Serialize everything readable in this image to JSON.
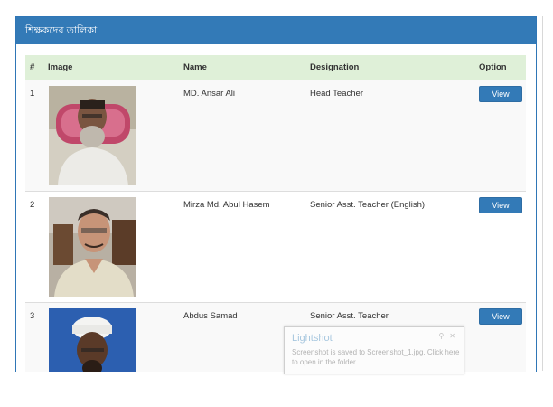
{
  "panel": {
    "title": "শিক্ষকদের তালিকা"
  },
  "table": {
    "headers": {
      "num": "#",
      "image": "Image",
      "name": "Name",
      "designation": "Designation",
      "option": "Option"
    },
    "rows": [
      {
        "num": "1",
        "name": "MD. Ansar Ali",
        "designation": "Head Teacher",
        "button": "View",
        "photo_alt": "teacher-photo"
      },
      {
        "num": "2",
        "name": "Mirza Md. Abul Hasem",
        "designation": "Senior Asst. Teacher (English)",
        "button": "View",
        "photo_alt": "teacher-photo"
      },
      {
        "num": "3",
        "name": "Abdus Samad",
        "designation": "Senior Asst. Teacher",
        "button": "View",
        "photo_alt": "teacher-photo"
      }
    ]
  },
  "toast": {
    "title": "Lightshot",
    "message": "Screenshot is saved to Screenshot_1.jpg. Click here to open in the folder."
  },
  "colors": {
    "primary": "#337ab7",
    "header_bg": "#dff0d8"
  }
}
